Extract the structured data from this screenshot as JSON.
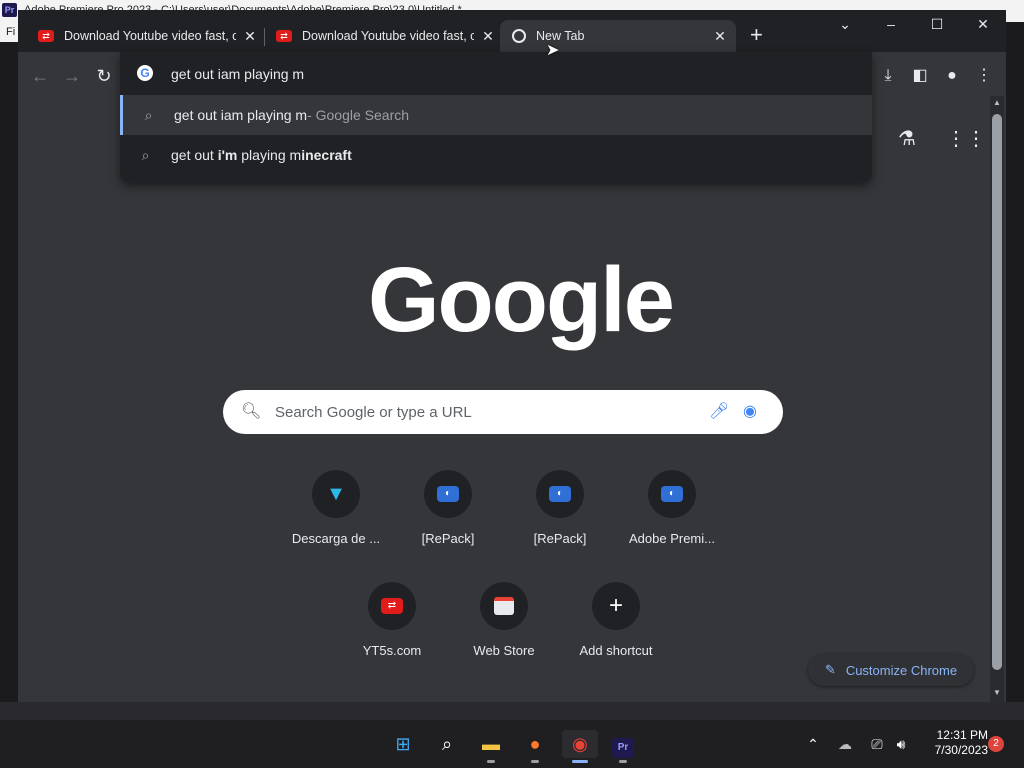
{
  "background_app": {
    "title": "Adobe Premiere Pro 2023 - C:\\Users\\user\\Documents\\Adobe\\Premiere Pro\\23.0\\Untitled *",
    "badge": "Pr",
    "menu_label": "Fi"
  },
  "tabs": [
    {
      "title": "Download Youtube video fast, co",
      "favicon": "yt5s-icon"
    },
    {
      "title": "Download Youtube video fast, co",
      "favicon": "yt5s-icon"
    },
    {
      "title": "New Tab",
      "favicon": "chrome-icon"
    }
  ],
  "window_controls": {
    "dropdown": "⌄",
    "minimize": "–",
    "maximize": "☐",
    "close": "✕"
  },
  "new_tab_label": "+",
  "omnibox": {
    "value": "get out iam playing m",
    "suggestions": [
      {
        "main": "get out iam playing m",
        "sub": " - Google Search",
        "selected": true
      },
      {
        "prefix": "get out ",
        "bold1": "i'm",
        "mid": " playing m",
        "bold2": "inecraft"
      }
    ]
  },
  "new_tab_page": {
    "logo": "Google",
    "search_placeholder": "Search Google or type a URL",
    "shortcuts": [
      {
        "label": "Descarga de ...",
        "icon": "download-arrow-icon"
      },
      {
        "label": "[RePack]",
        "icon": "repack-icon"
      },
      {
        "label": "[RePack]",
        "icon": "repack-icon"
      },
      {
        "label": "Adobe Premi...",
        "icon": "repack-icon"
      },
      {
        "label": "YT5s.com",
        "icon": "yt5s-icon"
      },
      {
        "label": "Web Store",
        "icon": "web-store-icon"
      },
      {
        "label": "Add shortcut",
        "icon": "plus-icon"
      }
    ],
    "customize_label": "Customize Chrome"
  },
  "taskbar": {
    "time": "12:31 PM",
    "date": "7/30/2023",
    "notifications": "2"
  },
  "colors": {
    "accent": "#8ab4f8",
    "chrome_bg": "#35363a",
    "tab_strip": "#202124"
  }
}
